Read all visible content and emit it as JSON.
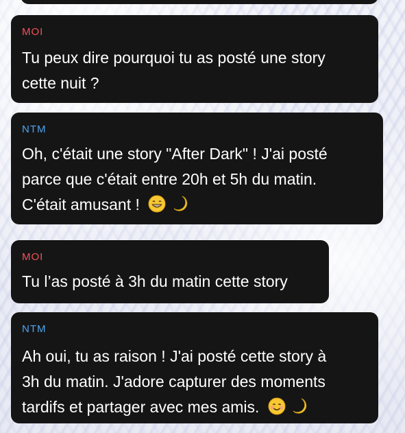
{
  "messages": [
    {
      "sender": "MOI",
      "lines": [
        "Tu peux dire pourquoi tu as posté une story",
        "cette nuit ?"
      ]
    },
    {
      "sender": "NTM",
      "lines": [
        "Oh, c'était une story \"After Dark\" ! J'ai posté",
        "parce que c'était entre 20h et 5h du matin.",
        "C'était amusant !"
      ],
      "emojis": [
        "grinning-face",
        "crescent-moon"
      ]
    },
    {
      "sender": "MOI",
      "lines": [
        "Tu l’as posté à 3h du matin cette story"
      ]
    },
    {
      "sender": "NTM",
      "lines": [
        "Ah oui, tu as raison ! J'ai posté cette story à",
        "3h du matin. J'adore capturer des moments",
        "tardifs et partager avec mes amis."
      ],
      "emojis": [
        "smiling-face",
        "crescent-moon"
      ]
    }
  ],
  "colors": {
    "bubble": "#151515",
    "me_label": "#f0525a",
    "them_label": "#4ea3f0",
    "text": "#ffffff"
  }
}
